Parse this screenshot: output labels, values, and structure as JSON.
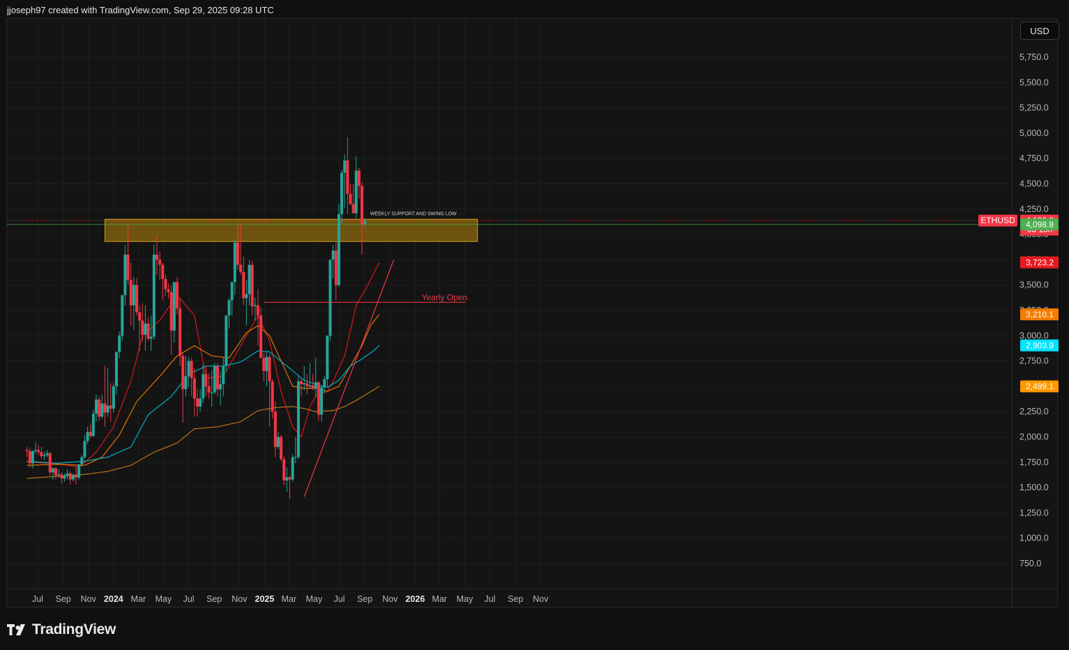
{
  "header": {
    "attribution": "jjoseph97 created with TradingView.com, Sep 29, 2025 09:28 UTC"
  },
  "currency_button": "USD",
  "footer": {
    "brand": "TradingView"
  },
  "symbol": "ETHUSD",
  "price_labels": {
    "last": {
      "value": "4,136.8",
      "sub": "6d 15h",
      "color": "#f23645"
    },
    "green": {
      "value": "4,098.8",
      "color": "#4caf50"
    },
    "ma_red": {
      "value": "3,723.2",
      "color": "#e8191e"
    },
    "ma_orange": {
      "value": "3,210.1",
      "color": "#f57c00"
    },
    "ma_cyan": {
      "value": "2,903.9",
      "color": "#00e5ff"
    },
    "ma_gold": {
      "value": "2,499.1",
      "color": "#ff9800"
    }
  },
  "annotations": {
    "zone_label": "WEEKLY SUPPORT AND SWING LOW",
    "yearly_open_label": "Yearly Open"
  },
  "colors": {
    "up": "#26a69a",
    "down": "#f23645",
    "zone": "#b8860b",
    "yearly_open": "#f23645"
  },
  "chart_data": {
    "type": "candlestick",
    "symbol": "ETHUSD",
    "interval": "weekly",
    "y_ticks": [
      750,
      1000,
      1250,
      1500,
      1750,
      2000,
      2250,
      2500,
      2750,
      3000,
      3250,
      3500,
      3750,
      4000,
      4250,
      4500,
      4750,
      5000,
      5250,
      5500,
      5750
    ],
    "y_tick_labels": [
      "750.0",
      "1,000.0",
      "1,250.0",
      "1,500.0",
      "1,750.0",
      "2,000.0",
      "2,250.0",
      "2,500.0",
      "2,750.0",
      "3,000.0",
      "3,250.0",
      "3,500.0",
      "3,750.0",
      "4,000.0",
      "4,250.0",
      "4,500.0",
      "4,750.0",
      "5,000.0",
      "5,250.0",
      "5,500.0",
      "5,750.0"
    ],
    "x_ticks": [
      {
        "label": "Jul",
        "date": "2023-07-01",
        "bold": false
      },
      {
        "label": "Sep",
        "date": "2023-09-01",
        "bold": false
      },
      {
        "label": "Nov",
        "date": "2023-11-01",
        "bold": false
      },
      {
        "label": "2024",
        "date": "2024-01-01",
        "bold": true
      },
      {
        "label": "Mar",
        "date": "2024-03-01",
        "bold": false
      },
      {
        "label": "May",
        "date": "2024-05-01",
        "bold": false
      },
      {
        "label": "Jul",
        "date": "2024-07-01",
        "bold": false
      },
      {
        "label": "Sep",
        "date": "2024-09-01",
        "bold": false
      },
      {
        "label": "Nov",
        "date": "2024-11-01",
        "bold": false
      },
      {
        "label": "2025",
        "date": "2025-01-01",
        "bold": true
      },
      {
        "label": "Mar",
        "date": "2025-03-01",
        "bold": false
      },
      {
        "label": "May",
        "date": "2025-05-01",
        "bold": false
      },
      {
        "label": "Jul",
        "date": "2025-07-01",
        "bold": false
      },
      {
        "label": "Sep",
        "date": "2025-09-01",
        "bold": false
      },
      {
        "label": "Nov",
        "date": "2025-11-01",
        "bold": false
      },
      {
        "label": "2026",
        "date": "2026-01-01",
        "bold": true
      },
      {
        "label": "Mar",
        "date": "2026-03-01",
        "bold": false
      },
      {
        "label": "May",
        "date": "2026-05-01",
        "bold": false
      },
      {
        "label": "Jul",
        "date": "2026-07-01",
        "bold": false
      },
      {
        "label": "Sep",
        "date": "2026-09-01",
        "bold": false
      },
      {
        "label": "Nov",
        "date": "2026-11-01",
        "bold": false
      }
    ],
    "first_candle_date": "2023-06-05",
    "candles": [
      [
        1870,
        1900,
        1800,
        1860
      ],
      [
        1860,
        1890,
        1700,
        1740
      ],
      [
        1740,
        1870,
        1690,
        1860
      ],
      [
        1860,
        1950,
        1830,
        1870
      ],
      [
        1870,
        1920,
        1820,
        1850
      ],
      [
        1850,
        1900,
        1780,
        1810
      ],
      [
        1810,
        1860,
        1770,
        1820
      ],
      [
        1820,
        1870,
        1800,
        1840
      ],
      [
        1840,
        1850,
        1620,
        1650
      ],
      [
        1650,
        1700,
        1580,
        1690
      ],
      [
        1690,
        1700,
        1580,
        1620
      ],
      [
        1620,
        1680,
        1600,
        1630
      ],
      [
        1630,
        1650,
        1540,
        1590
      ],
      [
        1590,
        1640,
        1560,
        1620
      ],
      [
        1620,
        1680,
        1580,
        1640
      ],
      [
        1640,
        1660,
        1530,
        1580
      ],
      [
        1580,
        1640,
        1560,
        1620
      ],
      [
        1620,
        1700,
        1530,
        1600
      ],
      [
        1600,
        1730,
        1580,
        1730
      ],
      [
        1730,
        1820,
        1710,
        1800
      ],
      [
        1800,
        2020,
        1780,
        1960
      ],
      [
        1960,
        2100,
        1930,
        2050
      ],
      [
        2050,
        2130,
        1990,
        2010
      ],
      [
        2010,
        2270,
        2000,
        2230
      ],
      [
        2230,
        2420,
        2150,
        2370
      ],
      [
        2370,
        2400,
        2160,
        2200
      ],
      [
        2200,
        2420,
        2180,
        2330
      ],
      [
        2330,
        2700,
        2100,
        2240
      ],
      [
        2240,
        2680,
        2200,
        2310
      ],
      [
        2310,
        2530,
        2150,
        2280
      ],
      [
        2280,
        2530,
        2240,
        2500
      ],
      [
        2500,
        2800,
        2420,
        2840
      ],
      [
        2840,
        3040,
        2780,
        3000
      ],
      [
        3000,
        3400,
        2950,
        3400
      ],
      [
        3400,
        3900,
        3300,
        3800
      ],
      [
        3800,
        4090,
        3500,
        3550
      ],
      [
        3550,
        3720,
        3100,
        3300
      ],
      [
        3300,
        3580,
        3060,
        3500
      ],
      [
        3500,
        3570,
        3200,
        3230
      ],
      [
        3230,
        3300,
        2850,
        3150
      ],
      [
        3150,
        3320,
        2950,
        3010
      ],
      [
        3010,
        3300,
        2850,
        3120
      ],
      [
        3120,
        3180,
        2950,
        2970
      ],
      [
        2970,
        3200,
        2850,
        2990
      ],
      [
        2990,
        3900,
        2960,
        3800
      ],
      [
        3800,
        3980,
        3600,
        3750
      ],
      [
        3750,
        3830,
        3550,
        3700
      ],
      [
        3700,
        3720,
        3350,
        3560
      ],
      [
        3560,
        3600,
        3390,
        3460
      ],
      [
        3460,
        3520,
        3370,
        3430
      ],
      [
        3430,
        3500,
        2810,
        3050
      ],
      [
        3050,
        3500,
        2930,
        3530
      ],
      [
        3530,
        3580,
        3210,
        3270
      ],
      [
        3270,
        3370,
        2700,
        2800
      ],
      [
        2800,
        2830,
        2140,
        2470
      ],
      [
        2470,
        2800,
        2400,
        2600
      ],
      [
        2600,
        2790,
        2490,
        2750
      ],
      [
        2750,
        2780,
        2400,
        2580
      ],
      [
        2580,
        2680,
        2200,
        2380
      ],
      [
        2380,
        2480,
        2200,
        2300
      ],
      [
        2300,
        2470,
        2250,
        2380
      ],
      [
        2380,
        2720,
        2330,
        2620
      ],
      [
        2620,
        2700,
        2400,
        2500
      ],
      [
        2500,
        2630,
        2380,
        2440
      ],
      [
        2440,
        2660,
        2300,
        2440
      ],
      [
        2440,
        2730,
        2420,
        2700
      ],
      [
        2700,
        2730,
        2400,
        2470
      ],
      [
        2470,
        2650,
        2310,
        2520
      ],
      [
        2520,
        2780,
        2400,
        2700
      ],
      [
        2700,
        3100,
        2650,
        3200
      ],
      [
        3200,
        3370,
        3070,
        3350
      ],
      [
        3350,
        3450,
        3200,
        3530
      ],
      [
        3530,
        3950,
        3400,
        3920
      ],
      [
        3920,
        4100,
        3650,
        3700
      ],
      [
        3700,
        4100,
        3600,
        3630
      ],
      [
        3630,
        3780,
        3300,
        3370
      ],
      [
        3370,
        3550,
        3100,
        3410
      ],
      [
        3410,
        3750,
        3300,
        3700
      ],
      [
        3700,
        3740,
        3200,
        3290
      ],
      [
        3290,
        3380,
        3150,
        3300
      ],
      [
        3300,
        3460,
        2900,
        3200
      ],
      [
        3200,
        3280,
        3000,
        2780
      ],
      [
        2780,
        2830,
        2550,
        2650
      ],
      [
        2650,
        2840,
        2500,
        2790
      ],
      [
        2790,
        2820,
        2100,
        2550
      ],
      [
        2550,
        2570,
        2180,
        2250
      ],
      [
        2250,
        2350,
        1800,
        1900
      ],
      [
        1900,
        2050,
        1880,
        2000
      ],
      [
        2000,
        2020,
        1760,
        1780
      ],
      [
        1780,
        1810,
        1520,
        1570
      ],
      [
        1570,
        1700,
        1460,
        1600
      ],
      [
        1600,
        1620,
        1390,
        1580
      ],
      [
        1580,
        1830,
        1560,
        1800
      ],
      [
        1800,
        2000,
        1740,
        1800
      ],
      [
        1800,
        2600,
        1780,
        2550
      ],
      [
        2550,
        2580,
        2400,
        2520
      ],
      [
        2520,
        2700,
        2460,
        2530
      ],
      [
        2530,
        2620,
        2420,
        2500
      ],
      [
        2500,
        2730,
        2480,
        2510
      ],
      [
        2510,
        2620,
        2460,
        2480
      ],
      [
        2480,
        2780,
        2400,
        2540
      ],
      [
        2540,
        2550,
        2160,
        2220
      ],
      [
        2220,
        2510,
        2150,
        2490
      ],
      [
        2490,
        2600,
        2440,
        2570
      ],
      [
        2570,
        2780,
        2500,
        3000
      ],
      [
        3000,
        3700,
        2950,
        3750
      ],
      [
        3750,
        3900,
        3560,
        3840
      ],
      [
        3840,
        3920,
        3350,
        3500
      ],
      [
        3500,
        4300,
        3480,
        4200
      ],
      [
        4200,
        4640,
        4100,
        4610
      ],
      [
        4610,
        4790,
        4260,
        4730
      ],
      [
        4730,
        4960,
        4200,
        4400
      ],
      [
        4400,
        4500,
        4290,
        4300
      ],
      [
        4300,
        4500,
        4200,
        4210
      ],
      [
        4210,
        4770,
        4160,
        4630
      ],
      [
        4630,
        4660,
        4350,
        4480
      ],
      [
        4480,
        4520,
        3800,
        4100
      ],
      [
        4100,
        4160,
        4080,
        4136.8
      ]
    ],
    "moving_averages": [
      {
        "color": "#e8191e",
        "last": 3723.2,
        "points": [
          [
            0,
            1750
          ],
          [
            10,
            1740
          ],
          [
            18,
            1700
          ],
          [
            24,
            1850
          ],
          [
            30,
            2100
          ],
          [
            36,
            2550
          ],
          [
            40,
            3000
          ],
          [
            46,
            3150
          ],
          [
            52,
            3400
          ],
          [
            58,
            3200
          ],
          [
            62,
            2580
          ],
          [
            68,
            2600
          ],
          [
            74,
            2900
          ],
          [
            80,
            3200
          ],
          [
            84,
            2950
          ],
          [
            88,
            2450
          ],
          [
            92,
            2100
          ],
          [
            95,
            2000
          ],
          [
            98,
            2300
          ],
          [
            100,
            2400
          ],
          [
            104,
            2450
          ],
          [
            106,
            2550
          ],
          [
            110,
            2800
          ],
          [
            114,
            3300
          ],
          [
            118,
            3500
          ],
          [
            122,
            3723.2
          ]
        ]
      },
      {
        "color": "#f57c00",
        "last": 3210.1,
        "points": [
          [
            0,
            1720
          ],
          [
            10,
            1730
          ],
          [
            20,
            1720
          ],
          [
            26,
            1800
          ],
          [
            32,
            2020
          ],
          [
            38,
            2350
          ],
          [
            46,
            2600
          ],
          [
            52,
            2800
          ],
          [
            58,
            2900
          ],
          [
            64,
            2800
          ],
          [
            70,
            2780
          ],
          [
            76,
            3030
          ],
          [
            80,
            3100
          ],
          [
            84,
            3000
          ],
          [
            88,
            2750
          ],
          [
            92,
            2500
          ],
          [
            96,
            2480
          ],
          [
            100,
            2480
          ],
          [
            104,
            2450
          ],
          [
            108,
            2500
          ],
          [
            112,
            2700
          ],
          [
            116,
            2900
          ],
          [
            119,
            3100
          ],
          [
            122,
            3210.1
          ]
        ]
      },
      {
        "color": "#00bcd4",
        "last": 2903.9,
        "points": [
          [
            0,
            1760
          ],
          [
            10,
            1740
          ],
          [
            20,
            1760
          ],
          [
            28,
            1800
          ],
          [
            36,
            1900
          ],
          [
            42,
            2220
          ],
          [
            50,
            2400
          ],
          [
            56,
            2620
          ],
          [
            62,
            2700
          ],
          [
            68,
            2700
          ],
          [
            74,
            2740
          ],
          [
            80,
            2850
          ],
          [
            84,
            2840
          ],
          [
            90,
            2700
          ],
          [
            96,
            2560
          ],
          [
            100,
            2520
          ],
          [
            104,
            2490
          ],
          [
            108,
            2560
          ],
          [
            112,
            2700
          ],
          [
            116,
            2770
          ],
          [
            120,
            2850
          ],
          [
            122,
            2903.9
          ]
        ]
      },
      {
        "color": "#c8821a",
        "last": 2499.1,
        "points": [
          [
            0,
            1590
          ],
          [
            10,
            1610
          ],
          [
            20,
            1630
          ],
          [
            28,
            1660
          ],
          [
            36,
            1720
          ],
          [
            44,
            1850
          ],
          [
            52,
            1940
          ],
          [
            58,
            2080
          ],
          [
            66,
            2100
          ],
          [
            74,
            2150
          ],
          [
            80,
            2260
          ],
          [
            86,
            2290
          ],
          [
            92,
            2300
          ],
          [
            96,
            2280
          ],
          [
            100,
            2250
          ],
          [
            106,
            2260
          ],
          [
            110,
            2300
          ],
          [
            114,
            2360
          ],
          [
            118,
            2430
          ],
          [
            122,
            2499.1
          ]
        ]
      }
    ],
    "support_zone": {
      "from_date": "2023-12-11",
      "to_date": "2026-06-01",
      "low": 3930,
      "high": 4150
    },
    "yearly_open": {
      "from_date": "2024-12-30",
      "to_date": "2026-05-04",
      "value": 3330
    },
    "trendline": {
      "from_date": "2025-04-07",
      "from_value": 1410,
      "to_date": "2025-11-10",
      "to_value": 3750
    },
    "last_price": 4136.8
  }
}
